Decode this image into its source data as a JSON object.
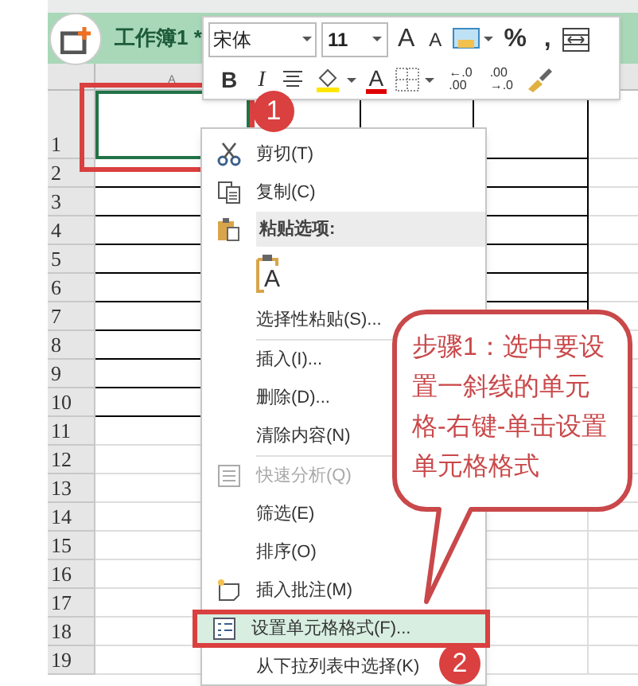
{
  "title_tab": {
    "label": "工作簿1 *"
  },
  "toolbar": {
    "font": "宋体",
    "size": "11",
    "row1": [
      {
        "kind": "grow",
        "label": "A"
      },
      {
        "kind": "shrink",
        "label": "A"
      },
      {
        "kind": "format"
      },
      {
        "kind": "text",
        "label": "%"
      },
      {
        "kind": "text",
        "label": ","
      },
      {
        "kind": "wrap"
      }
    ],
    "row2": [
      {
        "kind": "bold",
        "label": "B"
      },
      {
        "kind": "italic",
        "label": "I"
      },
      {
        "kind": "align"
      },
      {
        "kind": "fill"
      },
      {
        "kind": "fontcolor",
        "label": "A"
      },
      {
        "kind": "border"
      },
      {
        "kind": "decimal",
        "top": "←.0",
        "bottom": ".00"
      },
      {
        "kind": "decimal",
        "top": ".00",
        "bottom": "→.0"
      },
      {
        "kind": "brush"
      }
    ]
  },
  "sheet": {
    "column_header": "A",
    "rows": [
      "1",
      "2",
      "3",
      "4",
      "5",
      "6",
      "7",
      "8",
      "9",
      "10",
      "11",
      "12",
      "13",
      "14",
      "15",
      "16",
      "17",
      "18",
      "19"
    ]
  },
  "menu": [
    {
      "kind": "item",
      "label": "剪切(T)",
      "disabled": false,
      "selected": false
    },
    {
      "kind": "item",
      "label": "复制(C)",
      "disabled": false,
      "selected": false
    },
    {
      "kind": "header",
      "label": "粘贴选项:"
    },
    {
      "kind": "paste",
      "label": "A"
    },
    {
      "kind": "item",
      "label": "选择性粘贴(S)...",
      "disabled": false,
      "selected": false
    },
    {
      "kind": "separator"
    },
    {
      "kind": "item",
      "label": "插入(I)...",
      "disabled": false,
      "selected": false
    },
    {
      "kind": "item",
      "label": "删除(D)...",
      "disabled": false,
      "selected": false
    },
    {
      "kind": "item",
      "label": "清除内容(N)",
      "disabled": false,
      "selected": false
    },
    {
      "kind": "separator"
    },
    {
      "kind": "item",
      "label": "快速分析(Q)",
      "disabled": true,
      "selected": false
    },
    {
      "kind": "item",
      "label": "筛选(E)",
      "disabled": false,
      "selected": false
    },
    {
      "kind": "item",
      "label": "排序(O)",
      "disabled": false,
      "selected": false
    },
    {
      "kind": "item",
      "label": "插入批注(M)",
      "disabled": false,
      "selected": false
    },
    {
      "kind": "item",
      "label": "设置单元格格式(F)...",
      "disabled": false,
      "selected": true
    },
    {
      "kind": "item",
      "label": "从下拉列表中选择(K)",
      "disabled": false,
      "selected": false
    }
  ],
  "callout": {
    "text": "步骤1：选中要设置一斜线的单元格-右键-单击设置单元格格式"
  },
  "badges": [
    "1",
    "2"
  ]
}
